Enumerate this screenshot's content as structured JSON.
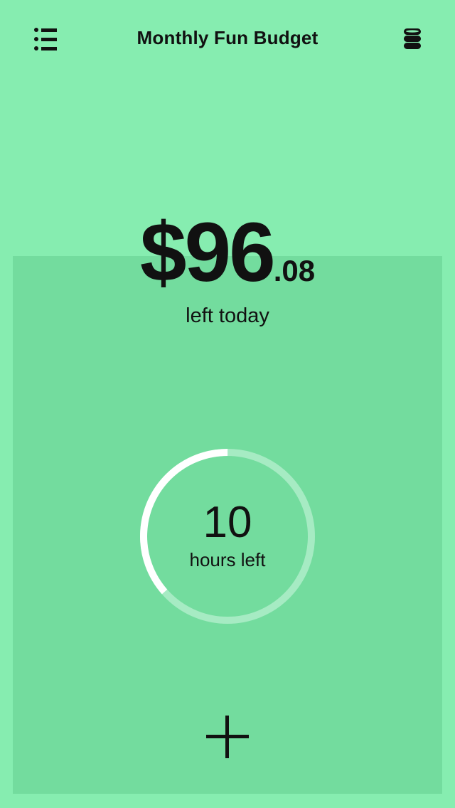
{
  "header": {
    "title": "Monthly Fun Budget",
    "left_icon": "list-icon",
    "right_icon": "database-icon"
  },
  "budget": {
    "currency": "$",
    "dollars": "96",
    "cents": ".08",
    "label": "left today"
  },
  "timer": {
    "hours": "10",
    "label": "hours left",
    "remaining_fraction": 0.365
  },
  "add": {
    "icon": "plus-icon"
  },
  "colors": {
    "background": "#86EDB0",
    "panel": "#73DC9E",
    "ring_progress": "#FFFFFF",
    "ring_track": "#A6EBC3",
    "text": "#111111"
  }
}
